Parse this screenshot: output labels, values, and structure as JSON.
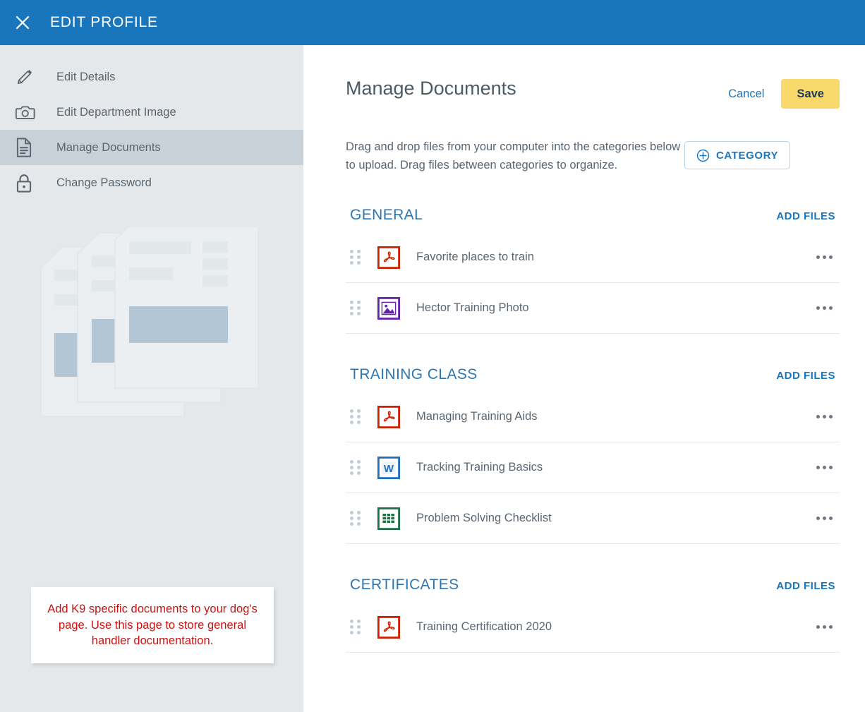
{
  "topbar": {
    "close_icon": "close-icon",
    "title": "EDIT PROFILE",
    "background": "#1a76bc"
  },
  "sidebar": {
    "items": [
      {
        "label": "Edit Details",
        "icon": "pencil-icon",
        "active": false
      },
      {
        "label": "Edit Department Image",
        "icon": "camera-icon",
        "active": false
      },
      {
        "label": "Manage Documents",
        "icon": "document-icon",
        "active": true
      },
      {
        "label": "Change Password",
        "icon": "lock-icon",
        "active": false
      }
    ],
    "illustration_icon": "stacked-documents-illustration",
    "annotation": "Add K9 specific documents to your dog's page. Use this page to store general handler documentation.",
    "annotation_color": "#cc1111"
  },
  "main": {
    "title": "Manage Documents",
    "cancel_label": "Cancel",
    "save_label": "Save",
    "save_color": "#f9d96b",
    "intro_text": "Drag and drop files from your computer into the categories below to upload. Drag files between categories to organize.",
    "category_button_label": "CATEGORY",
    "category_button_icon": "plus-circle-icon",
    "add_files_label": "ADD FILES",
    "row_menu_icon": "ellipsis-icon",
    "drag_handle_icon": "drag-handle-icon",
    "accent_color": "#1a76bc",
    "categories": [
      {
        "name": "GENERAL",
        "files": [
          {
            "name": "Favorite places to train",
            "icon": "pdf-file-icon",
            "type": "pdf"
          },
          {
            "name": "Hector Training Photo",
            "icon": "image-file-icon",
            "type": "image"
          }
        ]
      },
      {
        "name": "TRAINING CLASS",
        "files": [
          {
            "name": "Managing Training Aids",
            "icon": "pdf-file-icon",
            "type": "pdf"
          },
          {
            "name": "Tracking Training Basics",
            "icon": "word-file-icon",
            "type": "word"
          },
          {
            "name": "Problem Solving Checklist",
            "icon": "excel-file-icon",
            "type": "excel"
          }
        ]
      },
      {
        "name": "CERTIFICATES",
        "files": [
          {
            "name": "Training Certification 2020",
            "icon": "pdf-file-icon",
            "type": "pdf"
          }
        ]
      }
    ]
  }
}
